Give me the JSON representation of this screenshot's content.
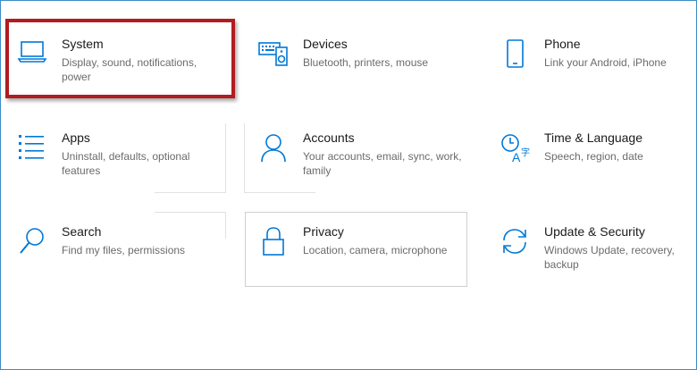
{
  "colors": {
    "accent": "#0078d7",
    "highlight": "#b01c1f"
  },
  "tiles": [
    {
      "id": "system",
      "icon": "laptop-icon",
      "title": "System",
      "desc": "Display, sound, notifications, power"
    },
    {
      "id": "devices",
      "icon": "keyboard-speaker-icon",
      "title": "Devices",
      "desc": "Bluetooth, printers, mouse"
    },
    {
      "id": "phone",
      "icon": "phone-icon",
      "title": "Phone",
      "desc": "Link your Android, iPhone"
    },
    {
      "id": "apps",
      "icon": "apps-list-icon",
      "title": "Apps",
      "desc": "Uninstall, defaults, optional features"
    },
    {
      "id": "accounts",
      "icon": "person-icon",
      "title": "Accounts",
      "desc": "Your accounts, email, sync, work, family"
    },
    {
      "id": "time-language",
      "icon": "time-language-icon",
      "title": "Time & Language",
      "desc": "Speech, region, date"
    },
    {
      "id": "search",
      "icon": "search-icon",
      "title": "Search",
      "desc": "Find my files, permissions"
    },
    {
      "id": "privacy",
      "icon": "lock-icon",
      "title": "Privacy",
      "desc": "Location, camera, microphone"
    },
    {
      "id": "update-security",
      "icon": "sync-icon",
      "title": "Update & Security",
      "desc": "Windows Update, recovery, backup"
    }
  ]
}
